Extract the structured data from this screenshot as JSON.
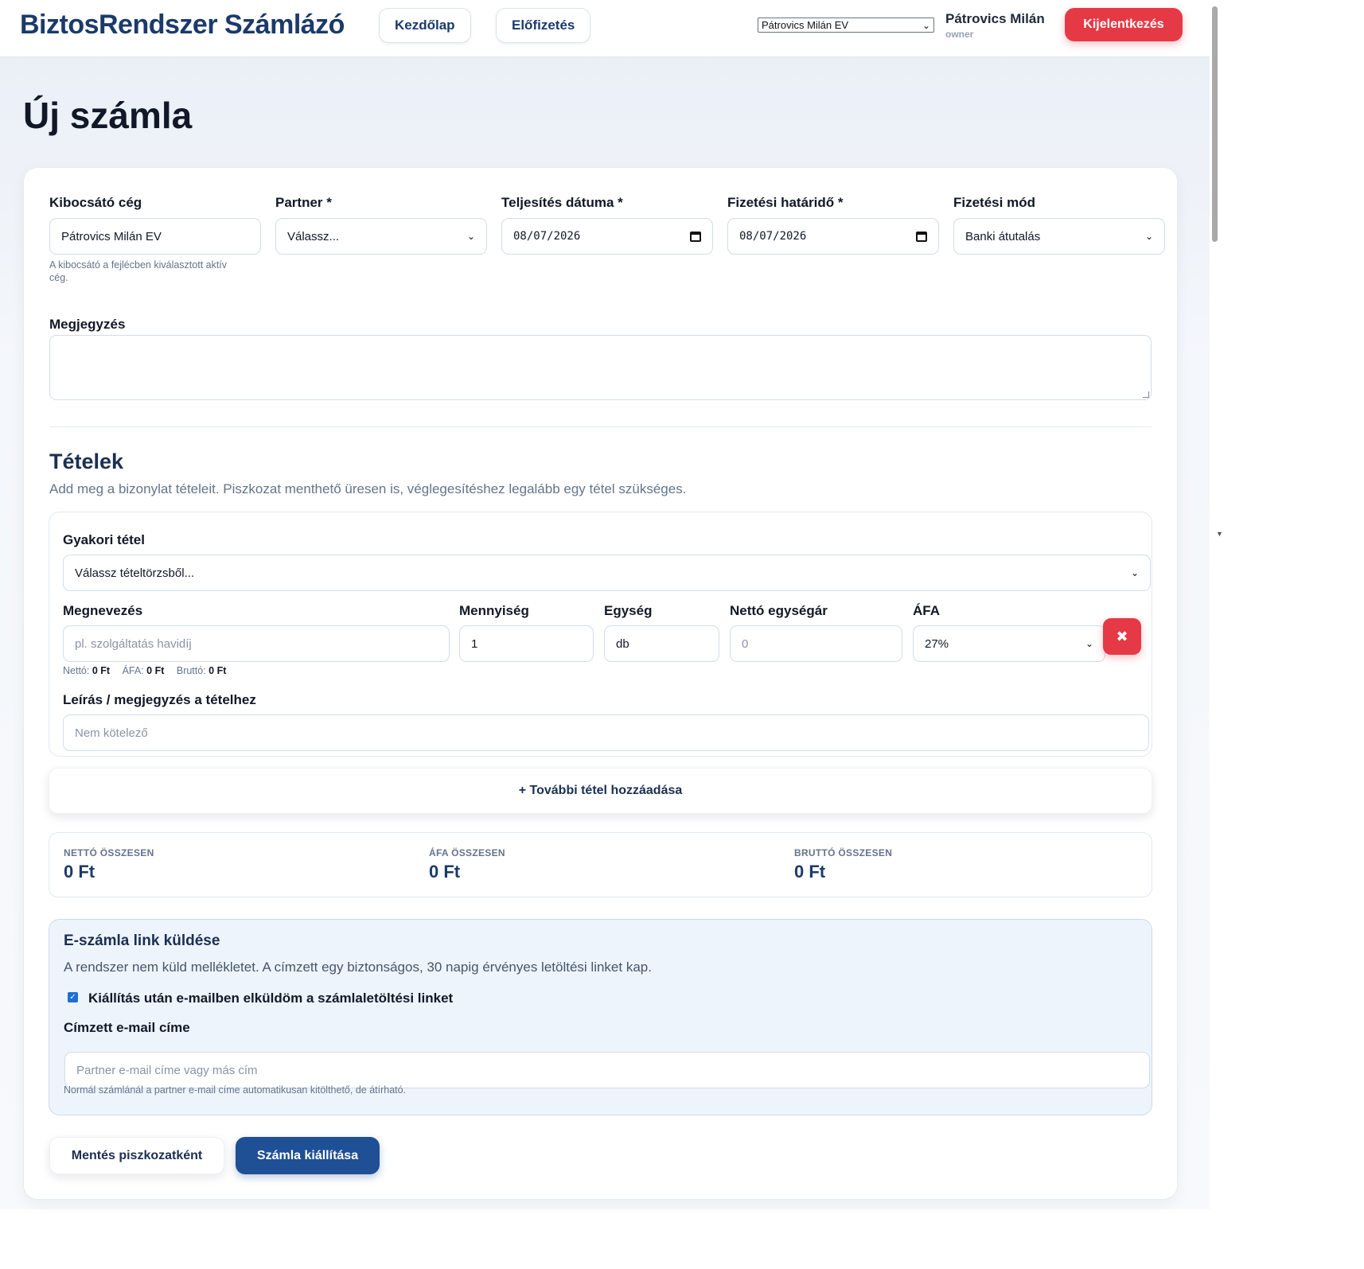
{
  "app": {
    "title": "BiztosRendszer Számlázó"
  },
  "nav": {
    "home": "Kezdőlap",
    "subscription": "Előfizetés"
  },
  "header": {
    "company_select": "Pátrovics Milán EV",
    "user_name": "Pátrovics Milán",
    "user_role": "owner",
    "logout": "Kijelentkezés"
  },
  "page": {
    "title": "Új számla"
  },
  "form": {
    "issuer": {
      "label": "Kibocsátó cég",
      "value": "Pátrovics Milán EV",
      "hint": "A kibocsátó a fejlécben kiválasztott aktív cég."
    },
    "partner": {
      "label": "Partner *",
      "value": "Válassz..."
    },
    "fulfillment_date": {
      "label": "Teljesítés dátuma *",
      "value": "08/07/2026"
    },
    "due_date": {
      "label": "Fizetési határidő *",
      "value": "08/07/2026"
    },
    "payment_method": {
      "label": "Fizetési mód",
      "value": "Banki átutalás"
    },
    "note": {
      "label": "Megjegyzés",
      "value": ""
    }
  },
  "items": {
    "title": "Tételek",
    "subtitle": "Add meg a bizonylat tételeit. Piszkozat menthető üresen is, véglegesítéshez legalább egy tétel szükséges.",
    "common_item": {
      "label": "Gyakori tétel",
      "value": "Válassz tételtörzsből..."
    },
    "name": {
      "label": "Megnevezés",
      "placeholder": "pl. szolgáltatás havidíj"
    },
    "quantity": {
      "label": "Mennyiség",
      "value": "1"
    },
    "unit": {
      "label": "Egység",
      "value": "db"
    },
    "net_unit_price": {
      "label": "Nettó egységár",
      "placeholder": "0"
    },
    "vat": {
      "label": "ÁFA",
      "value": "27%"
    },
    "remove_icon": "close-icon",
    "line_totals": {
      "net_label": "Nettó:",
      "net_value": "0 Ft",
      "vat_label": "ÁFA:",
      "vat_value": "0 Ft",
      "gross_label": "Bruttó:",
      "gross_value": "0 Ft"
    },
    "description": {
      "label": "Leírás / megjegyzés a tételhez",
      "placeholder": "Nem kötelező"
    },
    "add_button": "+ További tétel hozzáadása"
  },
  "totals": {
    "net_label": "NETTÓ ÖSSZESEN",
    "net_value": "0 Ft",
    "vat_label": "ÁFA ÖSSZESEN",
    "vat_value": "0 Ft",
    "gross_label": "BRUTTÓ ÖSSZESEN",
    "gross_value": "0 Ft"
  },
  "email": {
    "title": "E-számla link küldése",
    "subtitle": "A rendszer nem küld mellékletet. A címzett egy biztonságos, 30 napig érvényes letöltési linket kap.",
    "checkbox_label": "Kiállítás után e-mailben elküldöm a számlaletöltési linket",
    "checkbox_checked": true,
    "recipient_label": "Címzett e-mail címe",
    "recipient_placeholder": "Partner e-mail címe vagy más cím",
    "hint": "Normál számlánál a partner e-mail címe automatikusan kitölthető, de átírható."
  },
  "actions": {
    "save_draft": "Mentés piszkozatként",
    "issue": "Számla kiállítása"
  },
  "colors": {
    "brand": "#1b3a6b",
    "danger": "#e63946",
    "primary": "#1f4f95",
    "accent_blue": "#1d6fd8"
  }
}
